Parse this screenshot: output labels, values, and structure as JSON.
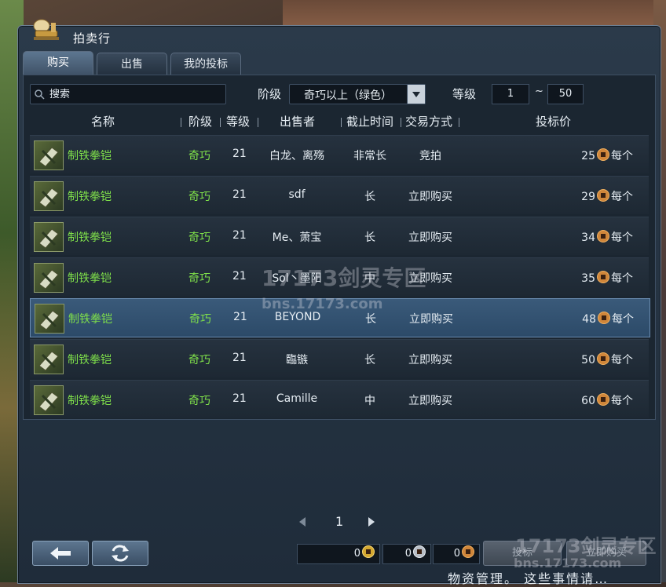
{
  "window": {
    "title": "拍卖行"
  },
  "tabs": [
    {
      "label": "购买",
      "active": true
    },
    {
      "label": "出售",
      "active": false
    },
    {
      "label": "我的投标",
      "active": false
    }
  ],
  "filters": {
    "search_placeholder": "搜索",
    "grade_label": "阶级",
    "grade_value": "奇巧以上（绿色）",
    "level_label": "等级",
    "level_min": "1",
    "level_separator": "~",
    "level_max": "50"
  },
  "columns": {
    "name": "名称",
    "grade": "阶级",
    "level": "等级",
    "seller": "出售者",
    "deadline": "截止时间",
    "trade_type": "交易方式",
    "bid_price": "投标价"
  },
  "rows": [
    {
      "name": "制铁拳铠",
      "grade": "奇巧",
      "level": "21",
      "seller": "白龙、离殇",
      "deadline": "非常长",
      "trade_type": "竞拍",
      "price": "25",
      "unit": "每个",
      "selected": false
    },
    {
      "name": "制铁拳铠",
      "grade": "奇巧",
      "level": "21",
      "seller": "sdf",
      "deadline": "长",
      "trade_type": "立即购买",
      "price": "29",
      "unit": "每个",
      "selected": false
    },
    {
      "name": "制铁拳铠",
      "grade": "奇巧",
      "level": "21",
      "seller": "Me、萧宝",
      "deadline": "长",
      "trade_type": "立即购买",
      "price": "34",
      "unit": "每个",
      "selected": false
    },
    {
      "name": "制铁拳铠",
      "grade": "奇巧",
      "level": "21",
      "seller": "Sol丶墨阳",
      "deadline": "中",
      "trade_type": "立即购买",
      "price": "35",
      "unit": "每个",
      "selected": false
    },
    {
      "name": "制铁拳铠",
      "grade": "奇巧",
      "level": "21",
      "seller": "BEYOND",
      "deadline": "长",
      "trade_type": "立即购买",
      "price": "48",
      "unit": "每个",
      "selected": true
    },
    {
      "name": "制铁拳铠",
      "grade": "奇巧",
      "level": "21",
      "seller": "臨镞",
      "deadline": "长",
      "trade_type": "立即购买",
      "price": "50",
      "unit": "每个",
      "selected": false
    },
    {
      "name": "制铁拳铠",
      "grade": "奇巧",
      "level": "21",
      "seller": "Camille",
      "deadline": "中",
      "trade_type": "立即购买",
      "price": "60",
      "unit": "每个",
      "selected": false
    }
  ],
  "pagination": {
    "current_page": "1"
  },
  "bottom": {
    "gold": "0",
    "silver": "0",
    "copper": "0",
    "bid_button": "投标",
    "buy_now_button": "立即购买"
  },
  "watermarks": {
    "logo_cn": "剑灵专区",
    "logo_num": "17173",
    "url": "bns.17173.com"
  },
  "footer": {
    "text": "物资管理。 这些事情请…"
  },
  "colors": {
    "grade_green": "#7fe04a",
    "accent_blue": "#3a5a7a"
  },
  "icons": [
    "auction-scale-icon",
    "search-icon",
    "dropdown-arrow-icon",
    "item-gauntlet-icon",
    "coin-icon",
    "back-arrow-icon",
    "refresh-icon"
  ]
}
